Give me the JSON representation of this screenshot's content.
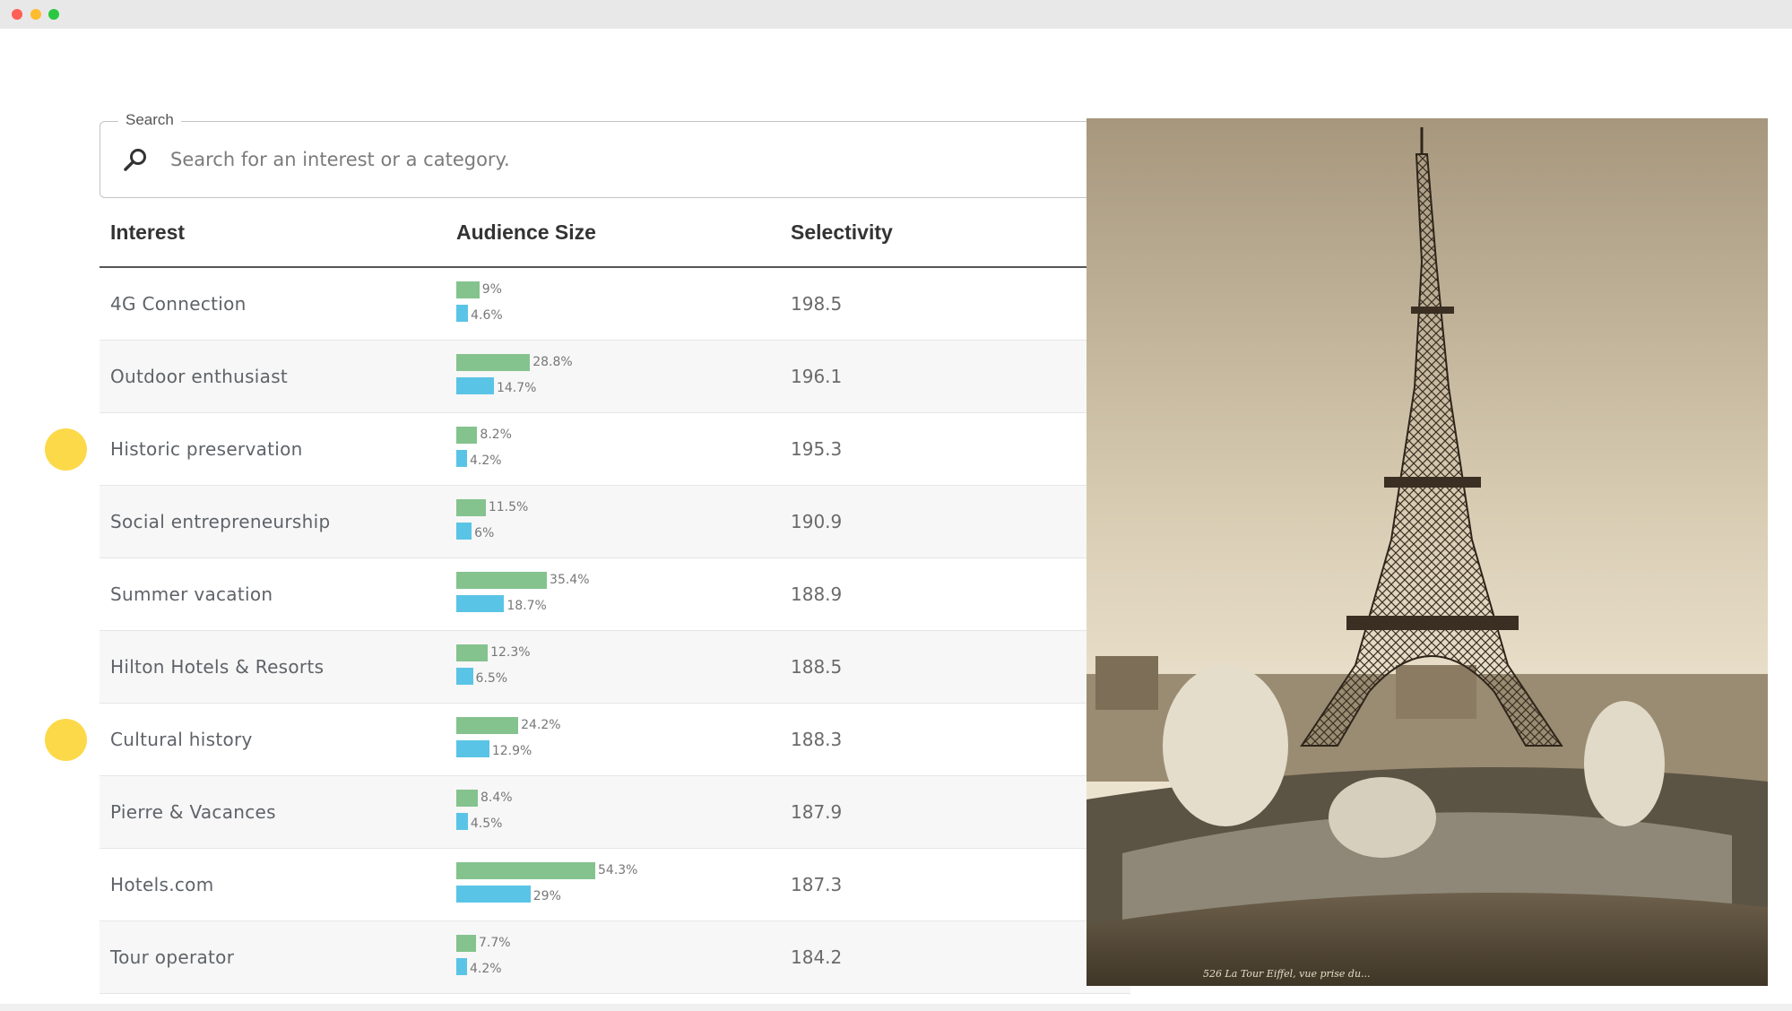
{
  "search": {
    "legend": "Search",
    "placeholder": "Search for an interest or a category."
  },
  "table": {
    "headers": [
      "Interest",
      "Audience Size",
      "Selectivity"
    ],
    "rows": [
      {
        "interest": "4G Connection",
        "green_pct": 9,
        "green_label": "9%",
        "blue_pct": 4.6,
        "blue_label": "4.6%",
        "selectivity": "198.5",
        "marked": false
      },
      {
        "interest": "Outdoor enthusiast",
        "green_pct": 28.8,
        "green_label": "28.8%",
        "blue_pct": 14.7,
        "blue_label": "14.7%",
        "selectivity": "196.1",
        "marked": false
      },
      {
        "interest": "Historic preservation",
        "green_pct": 8.2,
        "green_label": "8.2%",
        "blue_pct": 4.2,
        "blue_label": "4.2%",
        "selectivity": "195.3",
        "marked": true
      },
      {
        "interest": "Social entrepreneurship",
        "green_pct": 11.5,
        "green_label": "11.5%",
        "blue_pct": 6,
        "blue_label": "6%",
        "selectivity": "190.9",
        "marked": false
      },
      {
        "interest": "Summer vacation",
        "green_pct": 35.4,
        "green_label": "35.4%",
        "blue_pct": 18.7,
        "blue_label": "18.7%",
        "selectivity": "188.9",
        "marked": false
      },
      {
        "interest": "Hilton Hotels & Resorts",
        "green_pct": 12.3,
        "green_label": "12.3%",
        "blue_pct": 6.5,
        "blue_label": "6.5%",
        "selectivity": "188.5",
        "marked": false
      },
      {
        "interest": "Cultural history",
        "green_pct": 24.2,
        "green_label": "24.2%",
        "blue_pct": 12.9,
        "blue_label": "12.9%",
        "selectivity": "188.3",
        "marked": true
      },
      {
        "interest": "Pierre & Vacances",
        "green_pct": 8.4,
        "green_label": "8.4%",
        "blue_pct": 4.5,
        "blue_label": "4.5%",
        "selectivity": "187.9",
        "marked": false
      },
      {
        "interest": "Hotels.com",
        "green_pct": 54.3,
        "green_label": "54.3%",
        "blue_pct": 29,
        "blue_label": "29%",
        "selectivity": "187.3",
        "marked": false
      },
      {
        "interest": "Tour operator",
        "green_pct": 7.7,
        "green_label": "7.7%",
        "blue_pct": 4.2,
        "blue_label": "4.2%",
        "selectivity": "184.2",
        "marked": false
      }
    ]
  },
  "photo": {
    "subject": "sepia photograph of the Eiffel Tower",
    "caption": "526 La Tour Eiffel, vue prise du..."
  },
  "colors": {
    "audience_bar": "#84c38e",
    "comparison_bar": "#5ac4e6",
    "marker": "#fcd949",
    "sepia": "#c9b99a"
  }
}
